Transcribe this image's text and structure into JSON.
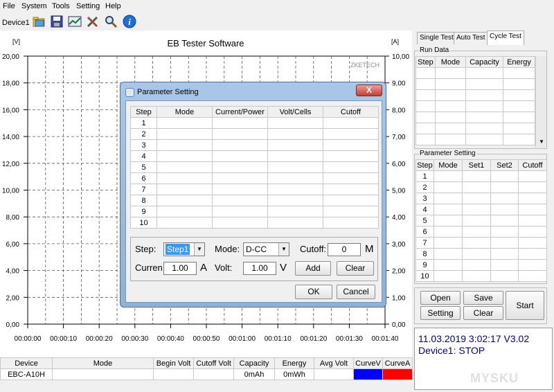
{
  "menu": [
    "File",
    "System",
    "Tools",
    "Setting",
    "Help"
  ],
  "toolbar": {
    "device": "Device1",
    "icons": [
      "open-folder-icon",
      "save-icon",
      "chart-picture-icon",
      "tools-icon",
      "search-icon",
      "info-icon"
    ]
  },
  "chart": {
    "title": "EB Tester Software",
    "left_unit": "[V]",
    "right_unit": "[A]",
    "watermark": "ZKETECH",
    "left_ticks": [
      "20,00",
      "18,00",
      "16,00",
      "14,00",
      "12,00",
      "10,00",
      "8,00",
      "6,00",
      "4,00",
      "2,00",
      "0,00"
    ],
    "right_ticks": [
      "10,00",
      "9,00",
      "8,00",
      "7,00",
      "6,00",
      "5,00",
      "4,00",
      "3,00",
      "2,00",
      "1,00",
      "0,00"
    ],
    "x_ticks": [
      "00:00:00",
      "00:00:10",
      "00:00:20",
      "00:00:30",
      "00:00:40",
      "00:00:50",
      "00:01:00",
      "00:01:10",
      "00:01:20",
      "00:01:30",
      "00:01:40"
    ]
  },
  "tabs": [
    "Single Test",
    "Auto Test",
    "Cycle Test"
  ],
  "run_data": {
    "title": "Run Data",
    "headers": [
      "Step",
      "Mode",
      "Capacity",
      "Energy"
    ]
  },
  "param_panel": {
    "title": "Parameter Setting",
    "headers": [
      "Step",
      "Mode",
      "Set1",
      "Set2",
      "Cutoff"
    ],
    "steps": [
      "1",
      "2",
      "3",
      "4",
      "5",
      "6",
      "7",
      "8",
      "9",
      "10"
    ]
  },
  "buttons": {
    "open": "Open",
    "save": "Save",
    "setting": "Setting",
    "clear": "Clear",
    "start": "Start"
  },
  "status": {
    "line1": "11.03.2019 3:02:17  V3.02",
    "line2": "Device1: STOP"
  },
  "bottom_table": {
    "headers": [
      "Device",
      "Mode",
      "Begin Volt",
      "Cutoff Volt",
      "Capacity",
      "Energy",
      "Avg Volt",
      "CurveV",
      "CurveA"
    ],
    "row": [
      "EBC-A10H",
      "",
      "",
      "",
      "0mAh",
      "0mWh",
      "",
      "",
      ""
    ],
    "colors": {
      "curve_v": "#0000ff",
      "curve_a": "#ff0000"
    }
  },
  "dialog": {
    "title": "Parameter Setting",
    "close": "X",
    "headers": [
      "Step",
      "Mode",
      "Current/Power",
      "Volt/Cells",
      "Cutoff"
    ],
    "steps": [
      "1",
      "2",
      "3",
      "4",
      "5",
      "6",
      "7",
      "8",
      "9",
      "10"
    ],
    "step_label": "Step:",
    "step_value": "Step1",
    "mode_label": "Mode:",
    "mode_value": "D-CC",
    "cutoff_label": "Cutoff:",
    "cutoff_value": "0",
    "cutoff_unit": "M",
    "current_label": "Curren",
    "current_value": "1.00",
    "current_unit": "A",
    "volt_label": "Volt:",
    "volt_value": "1.00",
    "volt_unit": "V",
    "add": "Add",
    "clear": "Clear",
    "ok": "OK",
    "cancel": "Cancel"
  },
  "watermark": "MYSKU"
}
